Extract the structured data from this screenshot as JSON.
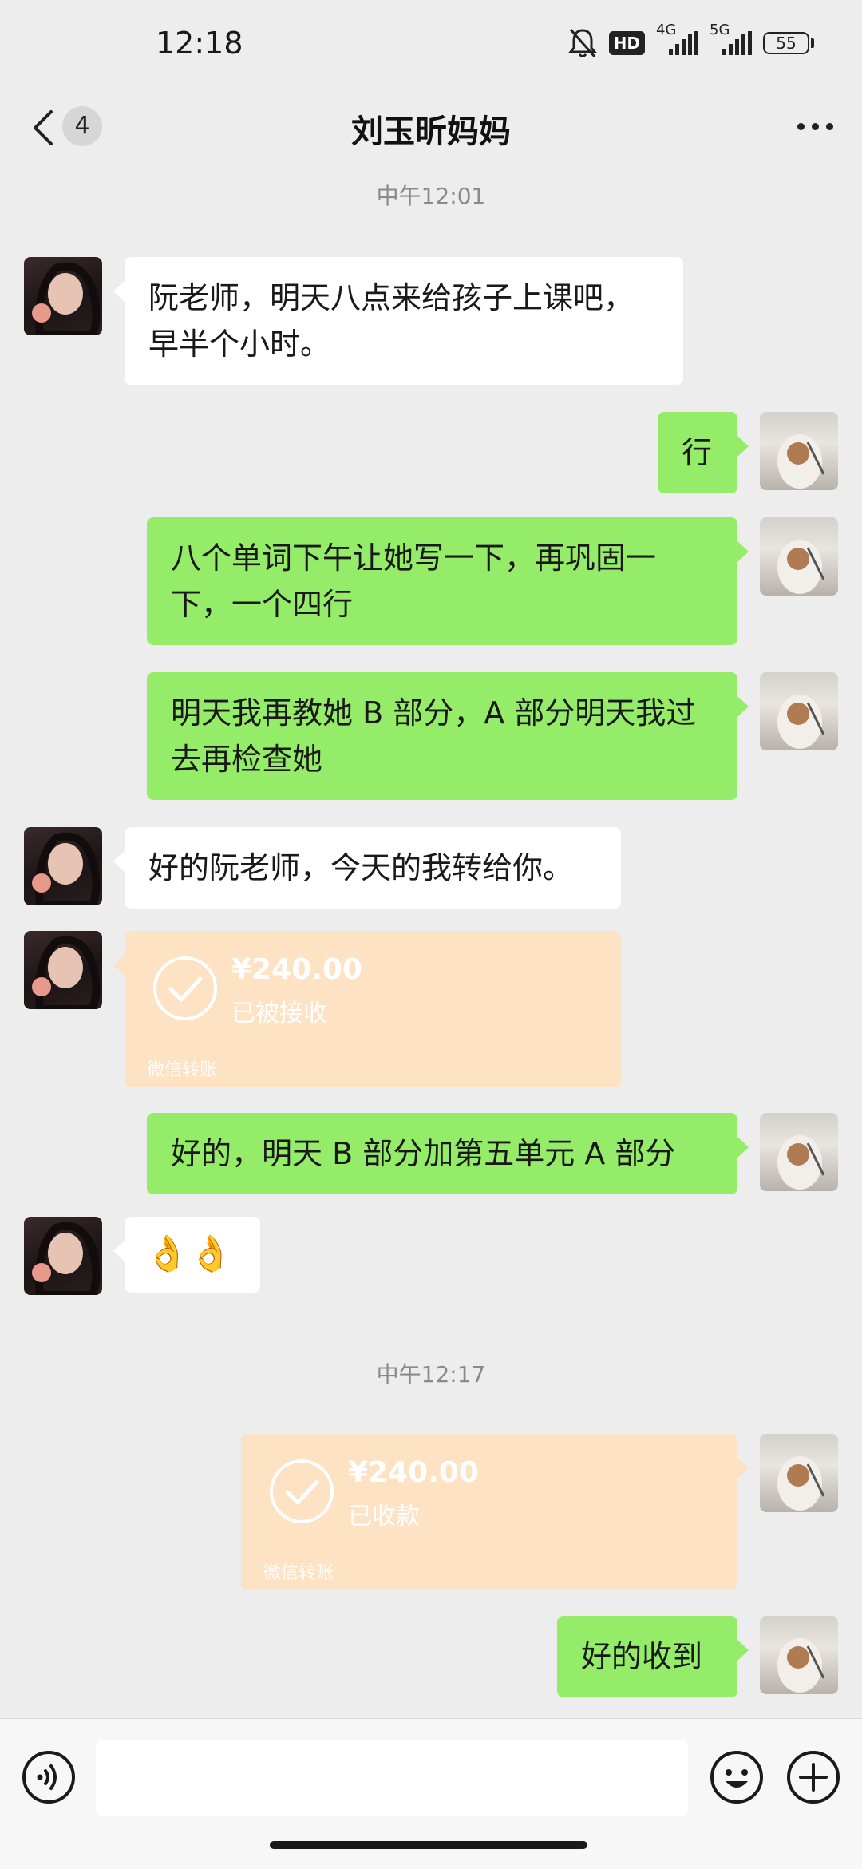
{
  "status_bar": {
    "time": "12:18",
    "hd_label": "HD",
    "net1": "4G",
    "net2": "5G",
    "battery": "55"
  },
  "header": {
    "title": "刘玉昕妈妈",
    "unread_count": "4"
  },
  "chat": {
    "timestamp1": "中午12:01",
    "timestamp2": "中午12:17",
    "messages": [
      {
        "side": "left",
        "text": "阮老师，明天八点来给孩子上课吧，早半个小时。"
      },
      {
        "side": "right",
        "text": "行"
      },
      {
        "side": "right",
        "text": "八个单词下午让她写一下，再巩固一下，一个四行"
      },
      {
        "side": "right",
        "text": "明天我再教她 B 部分，A 部分明天我过去再检查她"
      },
      {
        "side": "left",
        "text": "好的阮老师，今天的我转给你。"
      },
      {
        "side": "left",
        "type": "transfer",
        "amount": "¥240.00",
        "status": "已被接收",
        "label": "微信转账"
      },
      {
        "side": "right",
        "text": "好的，明天 B 部分加第五单元 A 部分"
      },
      {
        "side": "left",
        "text": "👌👌"
      },
      {
        "side": "right",
        "type": "transfer",
        "amount": "¥240.00",
        "status": "已收款",
        "label": "微信转账"
      },
      {
        "side": "right",
        "text": "好的收到"
      }
    ]
  },
  "colors": {
    "background": "#ededed",
    "bubble_self": "#95ec69",
    "bubble_other": "#ffffff",
    "transfer": "#fde2c4"
  },
  "icons": [
    "back-icon",
    "more-icon",
    "voice-icon",
    "emoji-icon",
    "plus-icon",
    "check-icon",
    "bell-muted-icon"
  ]
}
